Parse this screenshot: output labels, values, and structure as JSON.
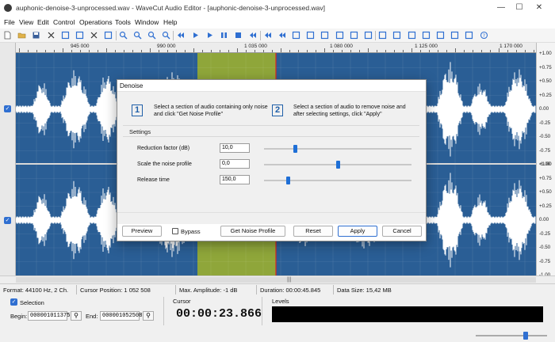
{
  "window": {
    "title": "auphonic-denoise-3-unprocessed.wav - WaveCut Audio Editor - [auphonic-denoise-3-unprocessed.wav]",
    "minimize": "—",
    "maximize": "☐",
    "close": "✕"
  },
  "menu": [
    "File",
    "View",
    "Edit",
    "Control",
    "Operations",
    "Tools",
    "Window",
    "Help"
  ],
  "toolbar": {
    "icons": [
      "new-icon",
      "open-icon",
      "save-icon",
      "cut-icon",
      "copy-icon",
      "paste-icon",
      "delete-icon",
      "crop-icon",
      "zoom-in-icon",
      "zoom-out-icon",
      "zoom-selection-icon",
      "zoom-all-icon",
      "go-start-icon",
      "play-icon",
      "play-selection-icon",
      "pause-icon",
      "stop-icon",
      "go-end-icon",
      "prev-icon",
      "next-icon",
      "loop-icon",
      "marker-icon",
      "select-all-icon",
      "undo-icon",
      "normalize-icon",
      "amplify-icon",
      "filter-icon",
      "eq-icon",
      "equalizer-icon",
      "effects-icon",
      "noise-icon",
      "spectrum-icon",
      "grid-icon",
      "help-icon"
    ]
  },
  "ruler": {
    "labels": [
      "945 000",
      "990 000",
      "1 035 000",
      "1 080 000",
      "1 125 000",
      "1 170 000"
    ]
  },
  "scale": {
    "labels": [
      "+1.00",
      "+0.75",
      "+0.50",
      "+0.25",
      "0.00",
      "-0.25",
      "-0.50",
      "-0.75",
      "-1.00"
    ]
  },
  "channels": [
    {
      "checked": true,
      "check_glyph": "✓"
    },
    {
      "checked": true,
      "check_glyph": "✓"
    }
  ],
  "status": {
    "format": "Format: 44100 Hz, 2 Ch.",
    "cursor_position": "Cursor Position: 1 052 508",
    "max_amplitude": "Max. Amplitude: -1 dB",
    "duration": "Duration: 00:00:45.845",
    "data_size": "Data Size: 15,42 MB"
  },
  "bottom": {
    "selection_label": "Selection",
    "begin_label": "Begin:",
    "begin_value": "000001011375",
    "end_label": "End:",
    "end_value": "000001052508",
    "cursor_label": "Cursor",
    "cursor_time": "00:00:23.866",
    "levels_label": "Levels",
    "pin_glyph": "⚲"
  },
  "dialog": {
    "title": "Denoise",
    "step1_num": "1",
    "step1_text": "Select a section of audio containing only noise and click \"Get Noise Profile\"",
    "step2_num": "2",
    "step2_text": "Select a section of audio to remove noise and after selecting settings, click \"Apply\"",
    "settings_label": "Settings",
    "params": [
      {
        "label": "Reduction factor (dB)",
        "value": "10,0",
        "slider_fraction": 0.21
      },
      {
        "label": "Scale the noise profile",
        "value": "0,0",
        "slider_fraction": 0.5
      },
      {
        "label": "Release time",
        "value": "150,0",
        "slider_fraction": 0.16
      }
    ],
    "preview": "Preview",
    "bypass": "Bypass",
    "get_noise_profile": "Get Noise Profile",
    "reset": "Reset",
    "apply": "Apply",
    "cancel": "Cancel"
  },
  "colors": {
    "wave_bg": "#2a5e95",
    "wave_fg": "#ffffff",
    "selection": "#8fa63a",
    "cursor_line": "#e0231e",
    "accent": "#2f6fd1"
  }
}
